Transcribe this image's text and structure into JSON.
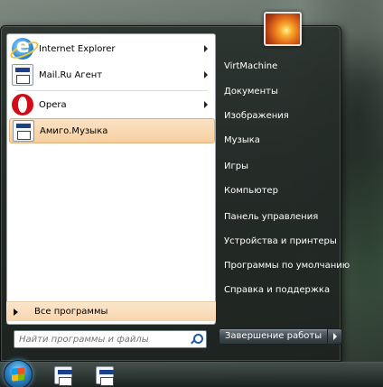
{
  "start_menu": {
    "pinned": [
      {
        "label": "Internet Explorer",
        "icon": "internet-explorer-icon",
        "submenu": true
      },
      {
        "label": "Mail.Ru Агент",
        "icon": "mailru-agent-icon",
        "submenu": true
      }
    ],
    "recent": [
      {
        "label": "Opera",
        "icon": "opera-icon",
        "submenu": true
      },
      {
        "label": "Амиго.Музыка",
        "icon": "amigo-music-icon",
        "submenu": false,
        "selected": true
      }
    ],
    "all_programs": "Все программы",
    "search": {
      "placeholder": "Найти программы и файлы",
      "value": ""
    },
    "right_links": [
      "VirtMachine",
      "Документы",
      "Изображения",
      "Музыка",
      "Игры",
      "Компьютер",
      "Панель управления",
      "Устройства и принтеры",
      "Программы по умолчанию",
      "Справка и поддержка"
    ],
    "shutdown_label": "Завершение работы"
  },
  "taskbar": {
    "pinned_icons": [
      "app-icon",
      "app-icon"
    ]
  },
  "colors": {
    "highlight": "#f6cfa0",
    "menu_dark": "#1c2220"
  }
}
